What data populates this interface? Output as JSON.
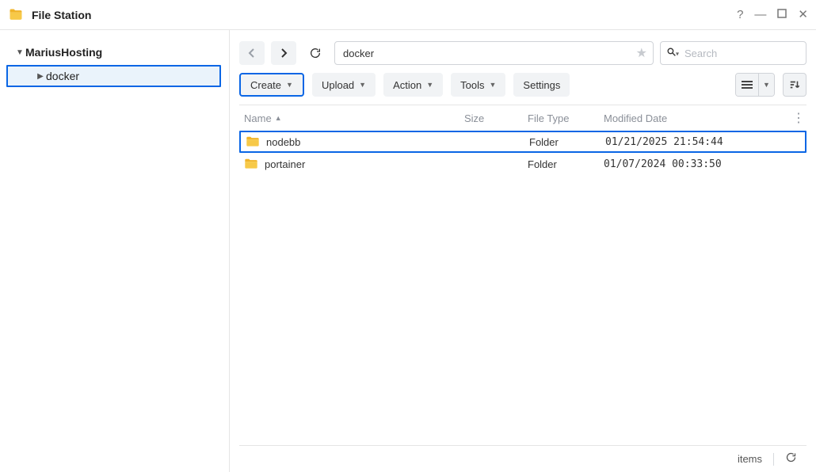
{
  "app": {
    "title": "File Station"
  },
  "sidebar": {
    "root": {
      "label": "MariusHosting"
    },
    "children": [
      {
        "label": "docker"
      }
    ]
  },
  "toolbar": {
    "path_value": "docker",
    "search_placeholder": "Search",
    "create_label": "Create",
    "upload_label": "Upload",
    "action_label": "Action",
    "tools_label": "Tools",
    "settings_label": "Settings"
  },
  "columns": {
    "name": "Name",
    "size": "Size",
    "type": "File Type",
    "date": "Modified Date"
  },
  "rows": [
    {
      "name": "nodebb",
      "size": "",
      "type": "Folder",
      "date": "01/21/2025 21:54:44",
      "highlight": true
    },
    {
      "name": "portainer",
      "size": "",
      "type": "Folder",
      "date": "01/07/2024 00:33:50",
      "highlight": false
    }
  ],
  "status": {
    "items_label": "items"
  }
}
